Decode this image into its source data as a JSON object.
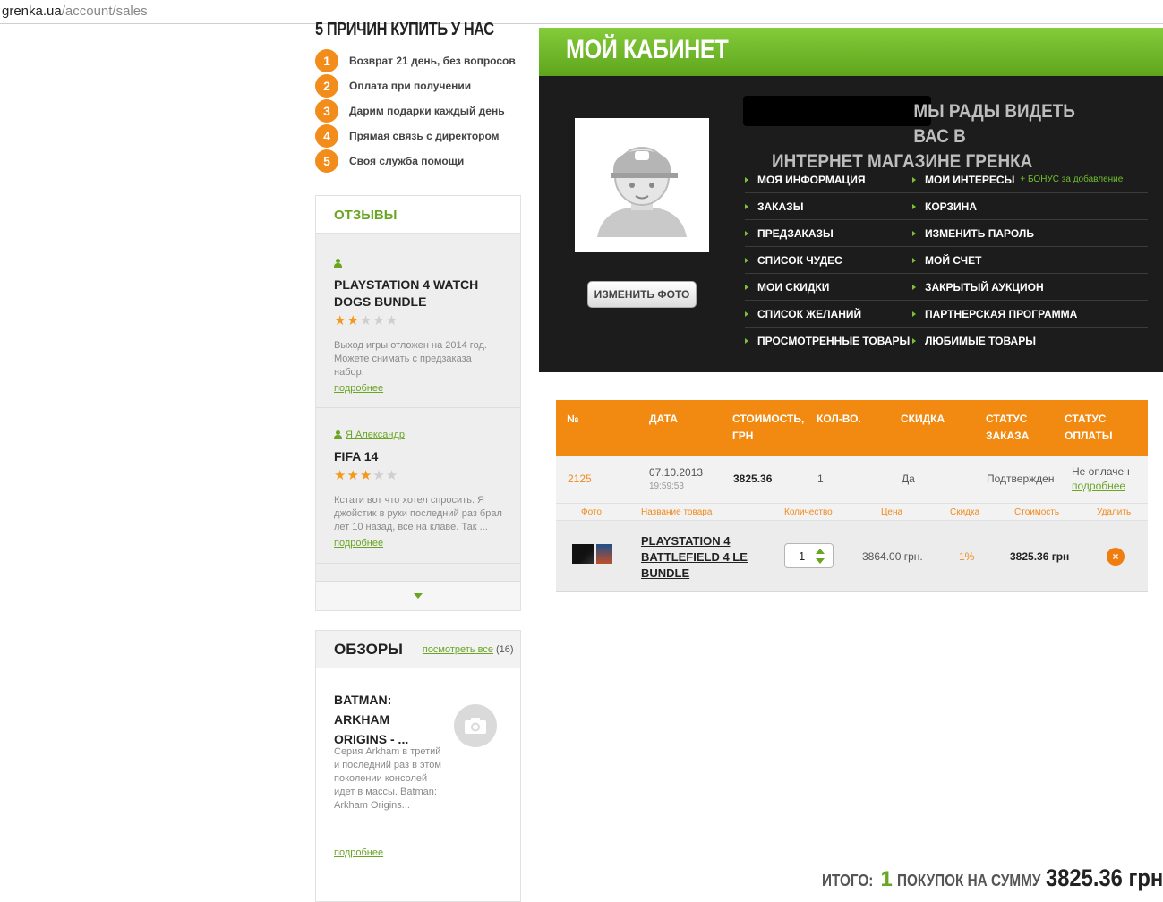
{
  "browser": {
    "url_host": "grenka.ua",
    "url_path": "/account/sales"
  },
  "reasons": {
    "title": "5 ПРИЧИН КУПИТЬ У НАС",
    "items": [
      {
        "num": "1",
        "text": "Возврат 21 день, без вопросов"
      },
      {
        "num": "2",
        "text": "Оплата при получении"
      },
      {
        "num": "3",
        "text": "Дарим подарки каждый день"
      },
      {
        "num": "4",
        "text": "Прямая связь с директором"
      },
      {
        "num": "5",
        "text": "Своя служба помощи"
      }
    ]
  },
  "reviews": {
    "title": "ОТЗЫВЫ",
    "items": [
      {
        "author": "",
        "title": "PLAYSTATION 4 WATCH DOGS BUNDLE",
        "rating": 2,
        "text": "Выход игры отложен на 2014 год. Можете снимать с предзаказа набор.",
        "more": "подробнее"
      },
      {
        "author": "Я Александр",
        "title": "FIFA 14",
        "rating": 3,
        "text": "Кстати вот что хотел спросить. Я джойстик в руки последний раз брал лет 10 назад, все на клаве. Так ...",
        "more": "подробнее"
      }
    ]
  },
  "articles": {
    "title": "ОБЗОРЫ",
    "see_all": "посмотреть все",
    "count": "(16)",
    "item": {
      "title": "BATMAN: ARKHAM ORIGINS - ...",
      "text": "Серия Arkham в третий и последний раз в этом поколении консолей идет в массы. Batman: Arkham Origins...",
      "more": "подробнее"
    }
  },
  "cabinet": {
    "title": "МОЙ КАБИНЕТ",
    "welcome_line1": "МЫ РАДЫ ВИДЕТЬ ВАС В",
    "welcome_line2": "ИНТЕРНЕТ МАГАЗИНЕ ГРЕНКА",
    "change_photo": "ИЗМЕНИТЬ ФОТО",
    "menu": [
      [
        "МОЯ ИНФОРМАЦИЯ",
        "МОИ ИНТЕРЕСЫ"
      ],
      [
        "ЗАКАЗЫ",
        "КОРЗИНА"
      ],
      [
        "ПРЕДЗАКАЗЫ",
        "ИЗМЕНИТЬ ПАРОЛЬ"
      ],
      [
        "СПИСОК ЧУДЕС",
        "МОЙ СЧЕТ"
      ],
      [
        "МОИ СКИДКИ",
        "ЗАКРЫТЫЙ АУКЦИОН"
      ],
      [
        "СПИСОК ЖЕЛАНИЙ",
        "ПАРТНЕРСКАЯ ПРОГРАММА"
      ],
      [
        "ПРОСМОТРЕННЫЕ ТОВАРЫ",
        "ЛЮБИМЫЕ ТОВАРЫ"
      ]
    ],
    "bonus": "+ БОНУС за добавление"
  },
  "orders": {
    "headers": [
      "№",
      "ДАТА",
      "СТОИМОСТЬ, ГРН",
      "КОЛ-ВО.",
      "СКИДКА",
      "СТАТУС ЗАКАЗА",
      "СТАТУС ОПЛАТЫ"
    ],
    "row": {
      "num": "2125",
      "date": "07.10.2013",
      "time": "19:59:53",
      "cost": "3825.36",
      "qty": "1",
      "discount": "Да",
      "status": "Подтвержден",
      "payment": "Не оплачен",
      "payment_more": "подробнее"
    },
    "sub_headers": [
      "Фото",
      "Название товара",
      "Количество",
      "Цена",
      "Скидка",
      "Стоимость",
      "Удалить"
    ],
    "item": {
      "name": "PLAYSTATION 4 BATTLEFIELD 4 LE BUNDLE",
      "qty": "1",
      "price": "3864.00 грн.",
      "discount": "1%",
      "cost": "3825.36 грн",
      "delete": "×"
    }
  },
  "total": {
    "label1": "ИТОГО:",
    "count": "1",
    "label2": "ПОКУПОК НА СУММУ",
    "sum": "3825.36 грн."
  },
  "colors": {
    "accent_green": "#6aa524",
    "accent_orange": "#f28a12",
    "dark_panel": "#1c1c1c"
  }
}
